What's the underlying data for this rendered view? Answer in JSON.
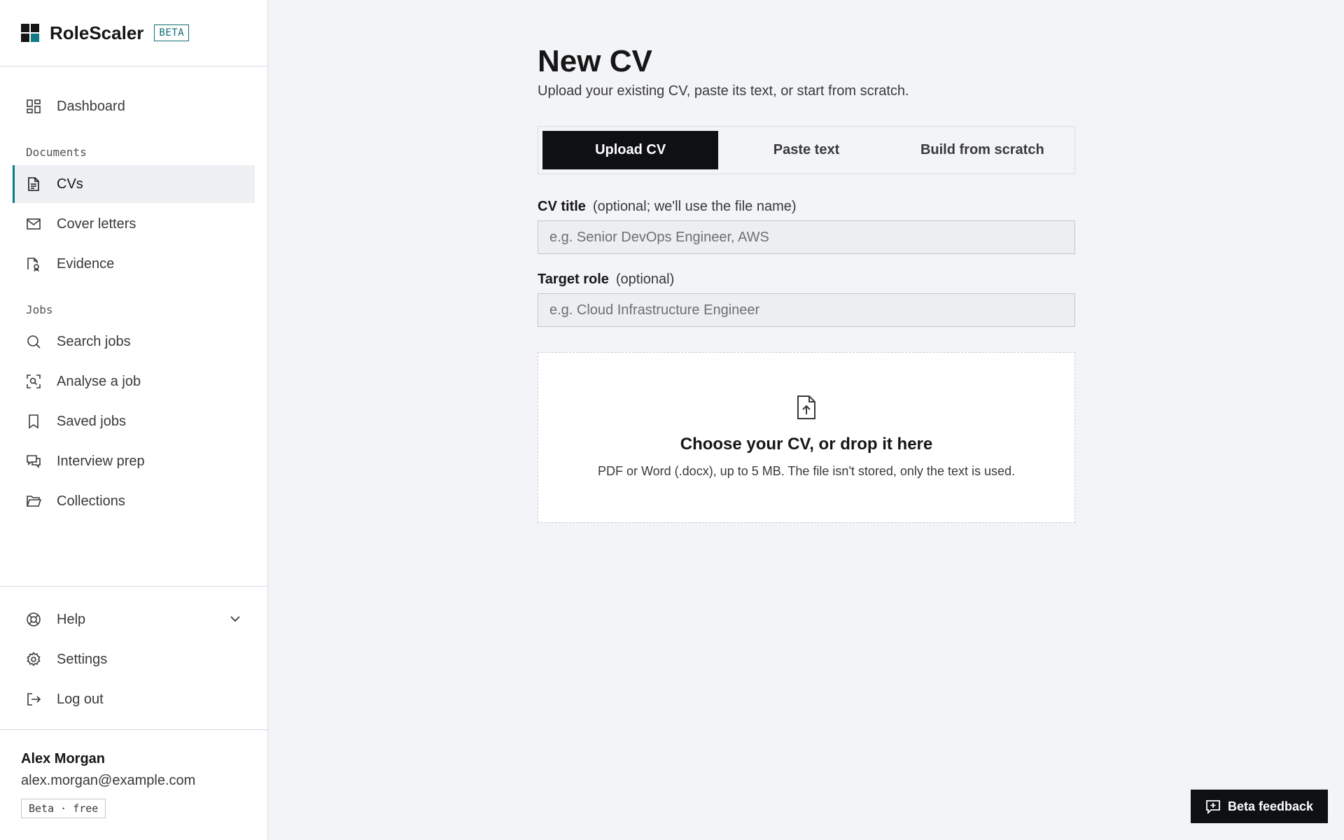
{
  "brand": {
    "name": "RoleScaler",
    "badge": "BETA"
  },
  "sidebar": {
    "dashboard": {
      "label": "Dashboard",
      "icon": "dashboard-icon"
    },
    "sections": {
      "documents": "Documents",
      "jobs": "Jobs"
    },
    "documents": [
      {
        "label": "CVs",
        "icon": "document-icon",
        "active": true
      },
      {
        "label": "Cover letters",
        "icon": "envelope-icon"
      },
      {
        "label": "Evidence",
        "icon": "evidence-icon"
      }
    ],
    "jobs": [
      {
        "label": "Search jobs",
        "icon": "search-icon"
      },
      {
        "label": "Analyse a job",
        "icon": "scan-icon"
      },
      {
        "label": "Saved jobs",
        "icon": "bookmark-icon"
      },
      {
        "label": "Interview prep",
        "icon": "chat-icon"
      },
      {
        "label": "Collections",
        "icon": "folder-icon"
      }
    ],
    "bottom": [
      {
        "label": "Help",
        "icon": "lifebuoy-icon"
      },
      {
        "label": "Settings",
        "icon": "gear-icon"
      },
      {
        "label": "Log out",
        "icon": "logout-icon"
      }
    ]
  },
  "user": {
    "name": "Alex Morgan",
    "email": "alex.morgan@example.com",
    "plan": "Beta · free"
  },
  "main": {
    "title": "New CV",
    "subtitle": "Upload your existing CV, paste its text, or start from scratch.",
    "tabs": [
      {
        "label": "Upload CV",
        "active": true
      },
      {
        "label": "Paste text"
      },
      {
        "label": "Build from scratch"
      }
    ],
    "cv_title": {
      "label": "CV title",
      "hint": "(optional; we'll use the file name)",
      "value": "",
      "placeholder": "e.g. Senior DevOps Engineer, AWS"
    },
    "target_role": {
      "label": "Target role",
      "hint": "(optional)",
      "value": "",
      "placeholder": "e.g. Cloud Infrastructure Engineer"
    },
    "dropzone": {
      "title": "Choose your CV, or drop it here",
      "subtitle": "PDF or Word (.docx), up to 5 MB. The file isn't stored, only the text is used."
    }
  },
  "feedback": {
    "label": "Beta feedback",
    "icon": "feedback-icon"
  },
  "colors": {
    "accent": "#0e7c86",
    "dark": "#0e1013",
    "background": "#f2f4f7"
  }
}
